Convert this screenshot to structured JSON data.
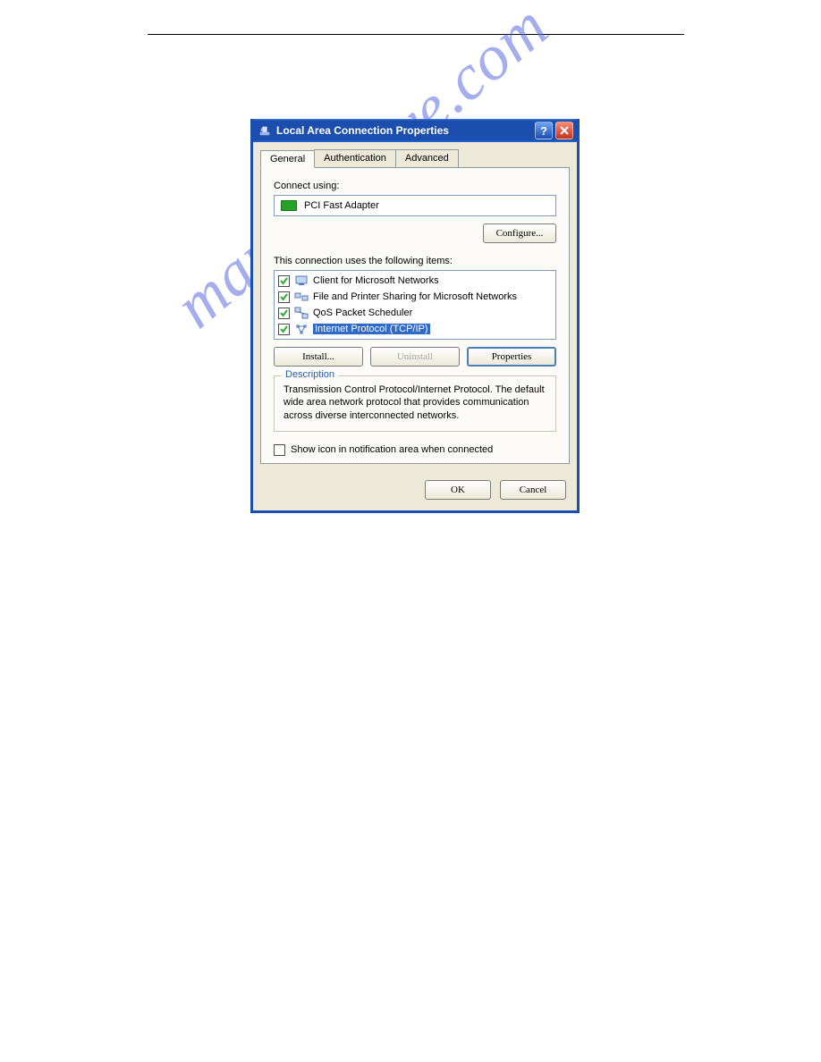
{
  "watermark_text": "manualshive.com",
  "window": {
    "title": "Local Area Connection Properties",
    "tabs": [
      "General",
      "Authentication",
      "Advanced"
    ],
    "active_tab": 0,
    "connect_using_label": "Connect using:",
    "adapter": "PCI Fast Adapter",
    "configure_btn": "Configure...",
    "items_label": "This connection uses the following items:",
    "items": [
      {
        "label": "Client for Microsoft Networks",
        "checked": true
      },
      {
        "label": "File and Printer Sharing for Microsoft Networks",
        "checked": true
      },
      {
        "label": "QoS Packet Scheduler",
        "checked": true
      },
      {
        "label": "Internet Protocol (TCP/IP)",
        "checked": true,
        "selected": true
      }
    ],
    "install_btn": "Install...",
    "uninstall_btn": "Uninstall",
    "properties_btn": "Properties",
    "description_legend": "Description",
    "description_text": "Transmission Control Protocol/Internet Protocol. The default wide area network protocol that provides communication across diverse interconnected networks.",
    "show_icon_label": "Show icon in notification area when connected",
    "show_icon_checked": false,
    "ok_btn": "OK",
    "cancel_btn": "Cancel"
  }
}
